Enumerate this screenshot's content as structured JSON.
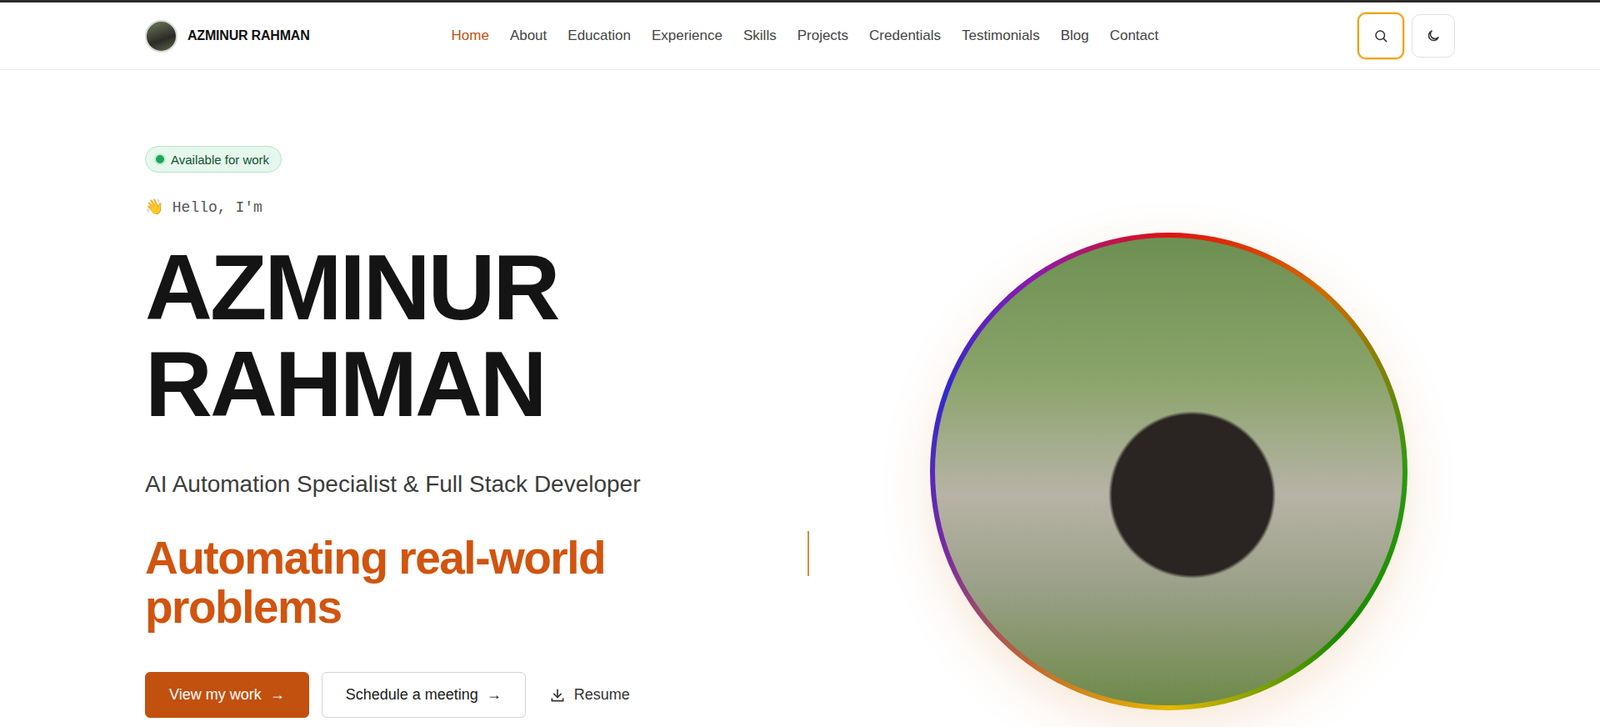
{
  "header": {
    "name": "AZMINUR RAHMAN"
  },
  "nav": [
    {
      "label": "Home",
      "selected": true
    },
    {
      "label": "About",
      "selected": false
    },
    {
      "label": "Education",
      "selected": false
    },
    {
      "label": "Experience",
      "selected": false
    },
    {
      "label": "Skills",
      "selected": false
    },
    {
      "label": "Projects",
      "selected": false
    },
    {
      "label": "Credentials",
      "selected": false
    },
    {
      "label": "Testimonials",
      "selected": false
    },
    {
      "label": "Blog",
      "selected": false
    },
    {
      "label": "Contact",
      "selected": false
    }
  ],
  "hero": {
    "availability": "Available for work",
    "greeting": "👋 Hello, I'm",
    "name_lines": [
      "AZMINUR",
      "RAHMAN"
    ],
    "title": "AI Automation Specialist & Full Stack Developer",
    "tagline": "Automating real-world problems",
    "buttons": [
      {
        "label": "View my work",
        "icon": "→",
        "kind": "primary"
      },
      {
        "label": "Schedule a meeting",
        "icon": "→",
        "kind": "secondary"
      },
      {
        "label": "Resume",
        "icon": "",
        "kind": "link"
      }
    ]
  }
}
